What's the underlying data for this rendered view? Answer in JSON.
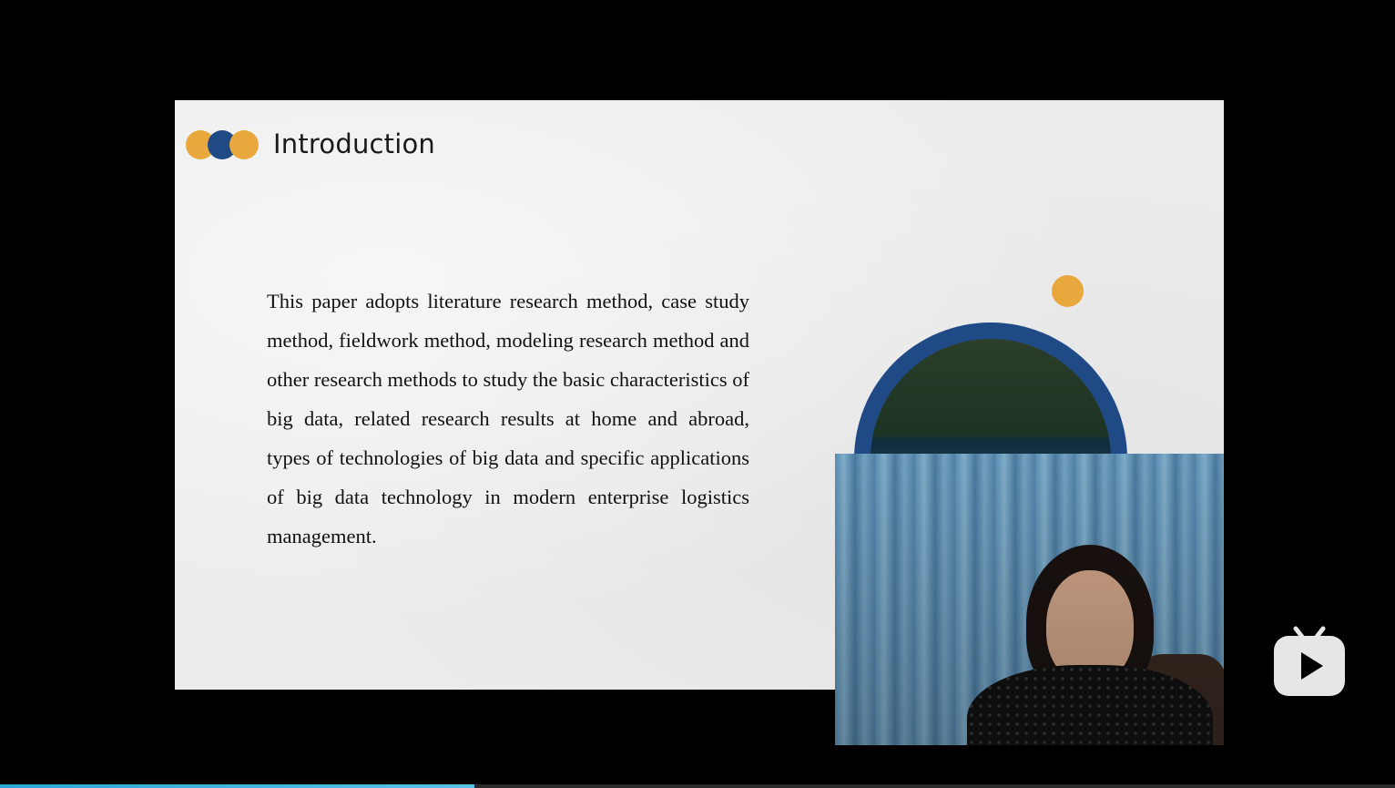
{
  "slide": {
    "title": "Introduction",
    "body": "This paper adopts literature research method, case study method, fieldwork method, modeling research method and other research methods to study the basic characteristics of big data, related research results at home and abroad, types of technologies of big data and specific applications of big data technology in modern enterprise logistics management.",
    "colors": {
      "accent_gold": "#e9a83e",
      "accent_navy": "#1f4a86"
    }
  },
  "player": {
    "logo_icon": "bilibili-tv-icon",
    "progress_fraction": 0.34,
    "progress_color": "#2aa6d6"
  }
}
